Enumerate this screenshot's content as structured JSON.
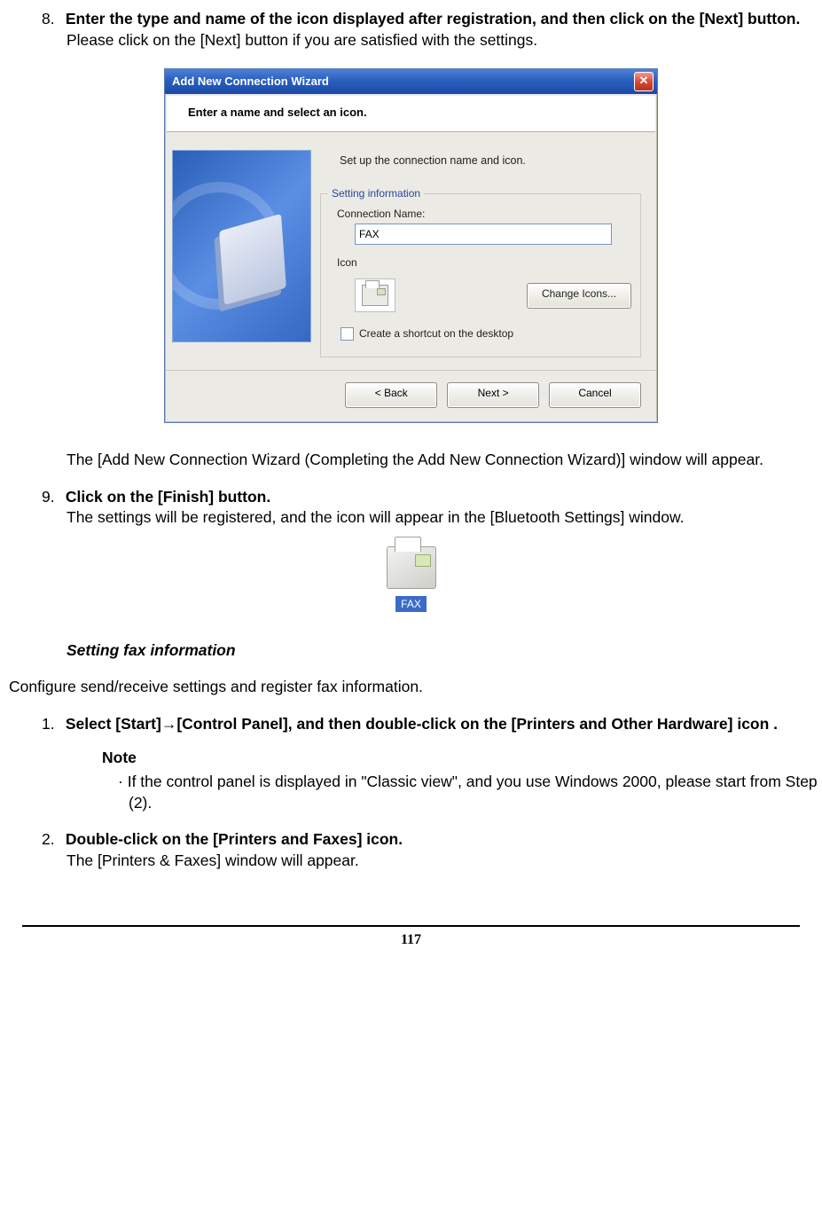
{
  "step8": {
    "num": "8.",
    "title": "Enter the type and name of the icon displayed after registration, and then click on the [Next] button.",
    "desc": "Please click on the [Next] button if you are satisfied with the settings.",
    "after": "The [Add New Connection Wizard (Completing the Add New Connection Wizard)] window will appear."
  },
  "wizard": {
    "title": "Add New Connection Wizard",
    "header": "Enter a name and select an icon.",
    "instruction": "Set up the connection name and icon.",
    "group_legend": "Setting information",
    "conn_label": "Connection Name:",
    "conn_value": "FAX",
    "icon_label": "Icon",
    "change_icons": "Change Icons...",
    "shortcut": "Create a shortcut on the desktop",
    "back": "< Back",
    "next": "Next >",
    "cancel": "Cancel"
  },
  "step9": {
    "num": "9.",
    "title": "Click on the [Finish] button.",
    "desc": "The settings will be registered, and the icon will appear in the [Bluetooth Settings] window."
  },
  "fax_icon_label": "FAX",
  "subheading": "Setting fax information",
  "intro": "Configure send/receive settings and register fax information.",
  "step1": {
    "num": "1.",
    "title": "Select [Start]→[Control Panel], and then double-click on the [Printers and Other Hardware] icon ."
  },
  "note": {
    "header": "Note",
    "body": "If the control panel is displayed in \"Classic view\", and you use Windows 2000, please start from Step (2)."
  },
  "step2": {
    "num": "2.",
    "title": "Double-click on the [Printers and Faxes] icon.",
    "desc": "The [Printers & Faxes] window will appear."
  },
  "page_number": "117"
}
